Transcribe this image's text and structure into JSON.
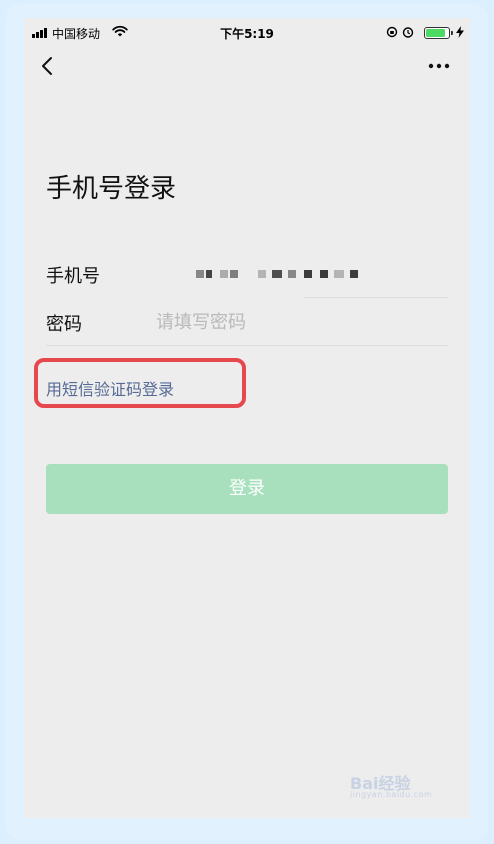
{
  "status_bar": {
    "carrier": "中国移动",
    "time": "下午5:19"
  },
  "nav": {
    "back_icon": "chevron-left-icon",
    "more_icon": "more-horizontal-icon"
  },
  "page": {
    "title": "手机号登录"
  },
  "form": {
    "phone_label": "手机号",
    "password_label": "密码",
    "password_placeholder": "请填写密码"
  },
  "sms_login_link": "用短信验证码登录",
  "login_button": "登录",
  "colors": {
    "link": "#576b95",
    "login_button_bg": "#a8e0be",
    "highlight_border": "#e5484d",
    "background": "#ededed"
  },
  "watermark": {
    "brand": "Bai经验",
    "url": "jingyan.baidu.com"
  }
}
